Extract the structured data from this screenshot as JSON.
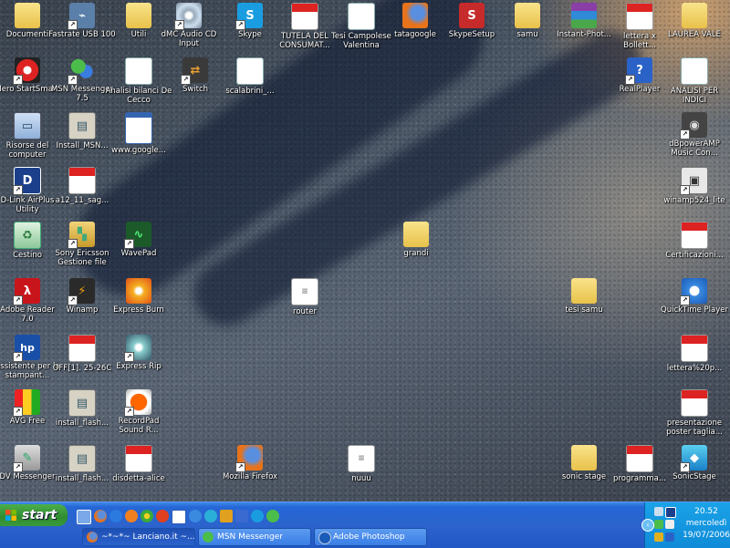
{
  "desktop": {
    "icons": [
      {
        "label": "Documenti",
        "x": "folder-docs"
      },
      {
        "label": "Fastrate USB 100"
      },
      {
        "label": "Utili"
      },
      {
        "label": "dMC Audio CD Input"
      },
      {
        "label": "Skype"
      },
      {
        "label": "TUTELA DEL CONSUMAT..."
      },
      {
        "label": "Tesi Campolese Valentina"
      },
      {
        "label": "tatagoogle"
      },
      {
        "label": "SkypeSetup"
      },
      {
        "label": "samu"
      },
      {
        "label": "Instant-Phot..."
      },
      {
        "label": "lettera x Bollett..."
      },
      {
        "label": "LAUREA VALE"
      },
      {
        "label": "Nero StartSmart"
      },
      {
        "label": "MSN Messenger 7.5"
      },
      {
        "label": "Analisi bilanci De Cecco"
      },
      {
        "label": "Switch"
      },
      {
        "label": "scalabrini_..."
      },
      {
        "label": "RealPlayer"
      },
      {
        "label": "ANALISI PER INDICI"
      },
      {
        "label": "Risorse del computer"
      },
      {
        "label": "Install_MSN..."
      },
      {
        "label": "www.google..."
      },
      {
        "label": "dBpowerAMP Music Con..."
      },
      {
        "label": "D-Link AirPlus Utility"
      },
      {
        "label": "a12_11_sag..."
      },
      {
        "label": "winamp524_lite"
      },
      {
        "label": "Cestino"
      },
      {
        "label": "Sony Ericsson Gestione file"
      },
      {
        "label": "WavePad"
      },
      {
        "label": "grandi"
      },
      {
        "label": "Certificazioni..."
      },
      {
        "label": "Adobe Reader 7.0"
      },
      {
        "label": "Winamp"
      },
      {
        "label": "Express Burn"
      },
      {
        "label": "router"
      },
      {
        "label": "tesi samu"
      },
      {
        "label": "QuickTime Player"
      },
      {
        "label": "Assistente per la stampant..."
      },
      {
        "label": "OFF[1]. 25-26C"
      },
      {
        "label": "Express Rip"
      },
      {
        "label": "lettera%20p..."
      },
      {
        "label": "AVG Free"
      },
      {
        "label": "install_flash..."
      },
      {
        "label": "RecordPad Sound R..."
      },
      {
        "label": "presentazione poster taglia..."
      },
      {
        "label": "DV Messenger"
      },
      {
        "label": "install_flash..."
      },
      {
        "label": "disdetta-alice"
      },
      {
        "label": "Mozilla Firefox"
      },
      {
        "label": "nuuu"
      },
      {
        "label": "sonic stage"
      },
      {
        "label": "programma..."
      },
      {
        "label": "SonicStage"
      }
    ]
  },
  "taskbar": {
    "start_label": "start",
    "tasks": [
      {
        "label": "~*~*~ Lanciano.it ~..."
      },
      {
        "label": "MSN Messenger"
      },
      {
        "label": "Adobe Photoshop"
      }
    ],
    "clock_time": "20.52",
    "clock_day": "mercoledì",
    "clock_date": "19/07/2006"
  },
  "colors": {
    "taskbar_blue": "#2566d6",
    "start_green": "#3a9a3a",
    "tray_blue": "#0f8bd8"
  }
}
